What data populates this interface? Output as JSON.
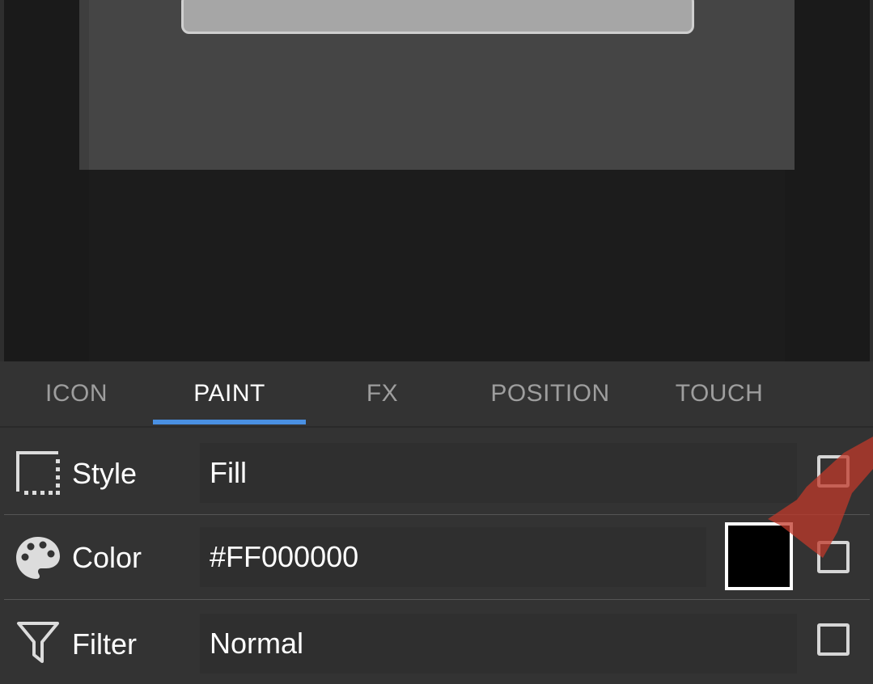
{
  "tabs": [
    {
      "label": "ICON",
      "active": false
    },
    {
      "label": "PAINT",
      "active": true
    },
    {
      "label": "FX",
      "active": false
    },
    {
      "label": "POSITION",
      "active": false
    },
    {
      "label": "TOUCH",
      "active": false
    }
  ],
  "rows": {
    "style": {
      "icon": "selection-icon",
      "label": "Style",
      "value": "Fill",
      "checked": false
    },
    "color": {
      "icon": "palette-icon",
      "label": "Color",
      "value": "#FF000000",
      "swatch_color": "#000000",
      "checked": false
    },
    "filter": {
      "icon": "filter-icon",
      "label": "Filter",
      "value": "Normal",
      "checked": false
    }
  },
  "colors": {
    "accent": "#4a90e2",
    "background": "#333333",
    "hint": "#c0392b"
  }
}
